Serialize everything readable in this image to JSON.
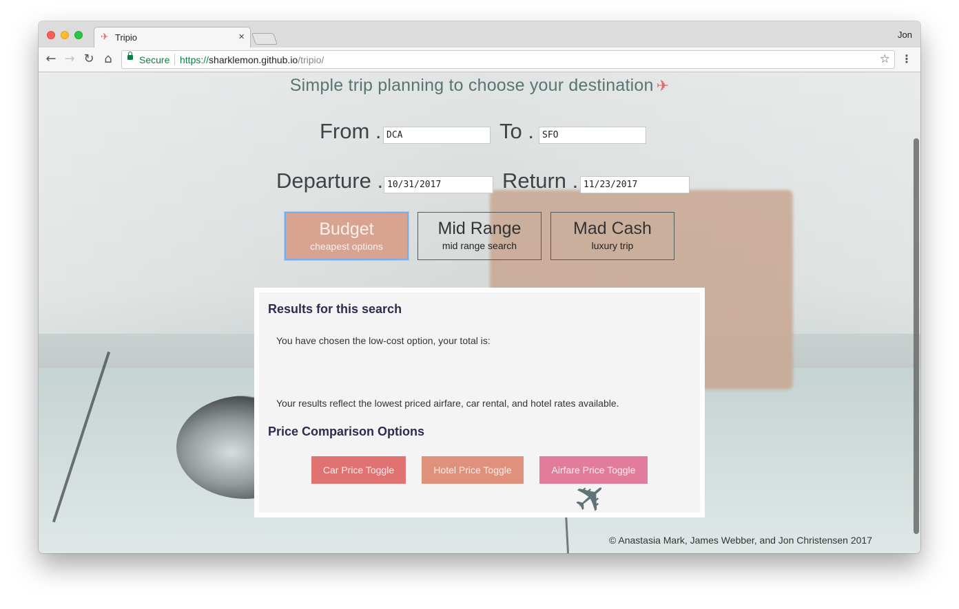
{
  "browser": {
    "tab_title": "Tripio",
    "tab_close": "×",
    "profile": "Jon",
    "secure_label": "Secure",
    "url_scheme": "https://",
    "url_host": "sharklemon.github.io",
    "url_path": "/tripio/"
  },
  "page": {
    "tagline": "Simple trip planning to choose your destination",
    "tagline_icon": "✈",
    "from_label": "From .",
    "from_value": "DCA",
    "to_label": "To .",
    "to_value": "SFO",
    "departure_label": "Departure .",
    "departure_value": "10/31/2017",
    "return_label": "Return .",
    "return_value": "11/23/2017",
    "options": [
      {
        "main": "Budget",
        "sub": "cheapest options"
      },
      {
        "main": "Mid Range",
        "sub": "mid range search"
      },
      {
        "main": "Mad Cash",
        "sub": "luxury trip"
      }
    ],
    "results": {
      "heading": "Results for this search",
      "line1": "You have chosen the low-cost option, your total is:",
      "line2": "Your results reflect the lowest priced airfare, car rental, and hotel rates available.",
      "compare_heading": "Price Comparison Options",
      "car_toggle": "Car Price Toggle",
      "hotel_toggle": "Hotel Price Toggle",
      "airfare_toggle": "Airfare Price Toggle"
    },
    "footer": "© Anastasia Mark, James Webber, and Jon Christensen 2017"
  },
  "colors": {
    "accent_red": "#e07272",
    "accent_salmon": "#e0917c",
    "accent_pink": "#e27c9c",
    "heading_navy": "#2b2d4f",
    "selected_option": "#d8a391"
  }
}
